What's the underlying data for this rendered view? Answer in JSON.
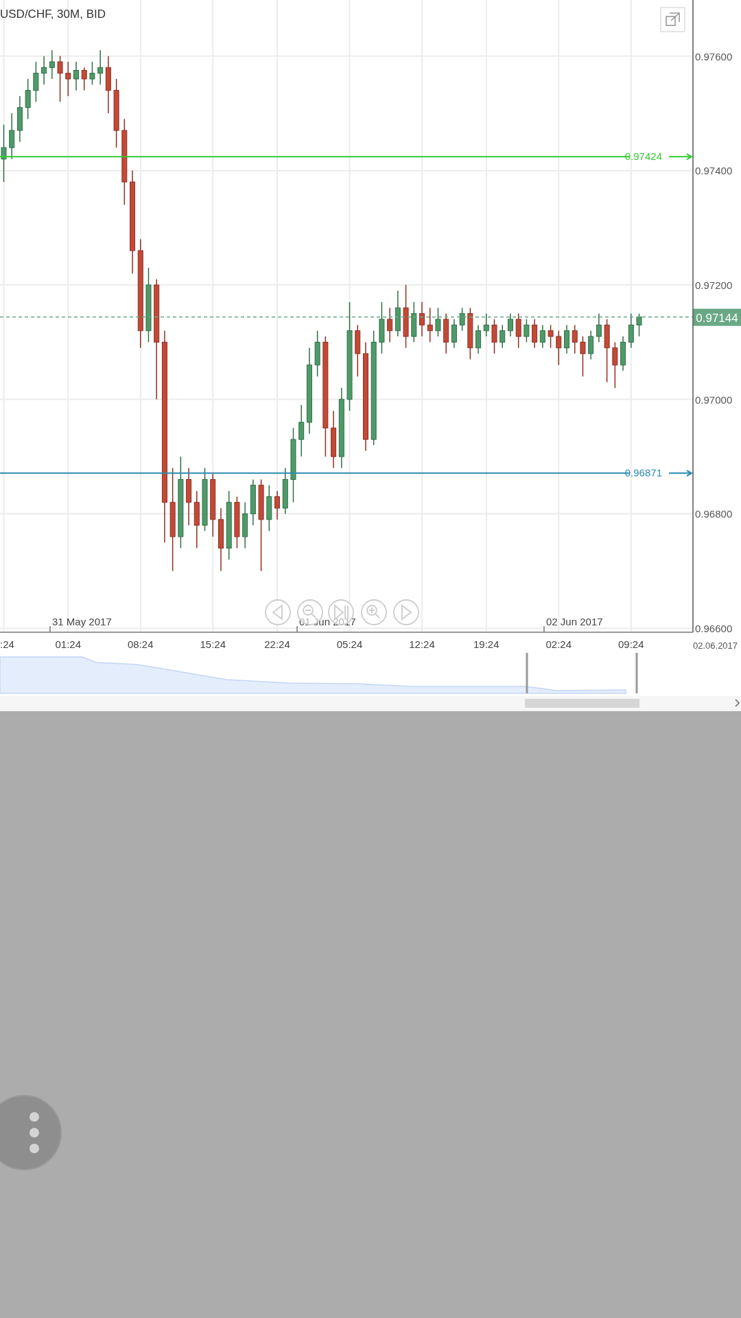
{
  "chart": {
    "title": "USD/CHF, 30M, BID",
    "date_labels": [
      "31 May 2017",
      "01 Jun 2017",
      "02 Jun 2017"
    ],
    "axis_date": "02.06.2017",
    "chart_data": {
      "type": "candlestick",
      "grid": true,
      "ylim": [
        0.96593,
        0.97698
      ],
      "ref_lines": [
        {
          "axis": "y",
          "value": 0.97424,
          "label": "0.97424",
          "color": "#33cc33"
        },
        {
          "axis": "y",
          "value": 0.96871,
          "label": "0.96871",
          "color": "#2a8bb0"
        },
        {
          "axis": "y",
          "value": 0.97144,
          "label": "0.97144",
          "color": "#6aa885"
        }
      ],
      "categories": [
        ":24",
        null,
        null,
        null,
        null,
        null,
        null,
        null,
        "01:24",
        null,
        null,
        null,
        null,
        null,
        null,
        null,
        null,
        "08:24",
        null,
        null,
        null,
        null,
        null,
        null,
        null,
        null,
        "15:24",
        null,
        null,
        null,
        null,
        null,
        null,
        null,
        "22:24",
        null,
        null,
        null,
        null,
        null,
        null,
        null,
        null,
        "05:24",
        null,
        null,
        null,
        null,
        null,
        null,
        null,
        null,
        "12:24",
        null,
        null,
        null,
        null,
        null,
        null,
        null,
        "19:24",
        null,
        null,
        null,
        null,
        null,
        null,
        null,
        null,
        "02:24",
        null,
        null,
        null,
        null,
        null,
        null,
        null,
        null,
        "09:24",
        null
      ],
      "yticks": [
        {
          "value": 0.976,
          "label": "0.97600"
        },
        {
          "value": 0.974,
          "label": "0.97400"
        },
        {
          "value": 0.972,
          "label": "0.97200"
        },
        {
          "value": 0.97,
          "label": "0.97000"
        },
        {
          "value": 0.968,
          "label": "0.96800"
        },
        {
          "value": 0.966,
          "label": "0.96600"
        }
      ],
      "ohlc": [
        [
          0.9742,
          0.9748,
          0.9738,
          0.9744
        ],
        [
          0.9744,
          0.975,
          0.9742,
          0.9747
        ],
        [
          0.9747,
          0.9753,
          0.9745,
          0.9751
        ],
        [
          0.9751,
          0.9756,
          0.9749,
          0.9754
        ],
        [
          0.9754,
          0.9759,
          0.9752,
          0.9757
        ],
        [
          0.9757,
          0.976,
          0.9755,
          0.9758
        ],
        [
          0.9758,
          0.9761,
          0.9756,
          0.9759
        ],
        [
          0.9759,
          0.976,
          0.9752,
          0.9757
        ],
        [
          0.9757,
          0.9759,
          0.9753,
          0.9756
        ],
        [
          0.9756,
          0.9759,
          0.9754,
          0.97575
        ],
        [
          0.97575,
          0.9758,
          0.9754,
          0.9756
        ],
        [
          0.9756,
          0.9759,
          0.9755,
          0.9757
        ],
        [
          0.9757,
          0.9761,
          0.9755,
          0.9758
        ],
        [
          0.9758,
          0.976,
          0.975,
          0.9754
        ],
        [
          0.9754,
          0.9756,
          0.9744,
          0.9747
        ],
        [
          0.9747,
          0.9749,
          0.9734,
          0.9738
        ],
        [
          0.9738,
          0.974,
          0.9722,
          0.9726
        ],
        [
          0.9726,
          0.9728,
          0.9709,
          0.9712
        ],
        [
          0.9712,
          0.9723,
          0.971,
          0.972
        ],
        [
          0.972,
          0.9721,
          0.97,
          0.971
        ],
        [
          0.971,
          0.9712,
          0.9675,
          0.9682
        ],
        [
          0.9682,
          0.9688,
          0.967,
          0.9676
        ],
        [
          0.9676,
          0.969,
          0.9674,
          0.9686
        ],
        [
          0.9686,
          0.9688,
          0.9678,
          0.9682
        ],
        [
          0.9682,
          0.9684,
          0.9674,
          0.9678
        ],
        [
          0.9678,
          0.9688,
          0.9677,
          0.9686
        ],
        [
          0.9686,
          0.9687,
          0.9676,
          0.9679
        ],
        [
          0.9679,
          0.9681,
          0.967,
          0.9674
        ],
        [
          0.9674,
          0.9684,
          0.9672,
          0.9682
        ],
        [
          0.9682,
          0.9683,
          0.9674,
          0.9676
        ],
        [
          0.9676,
          0.9682,
          0.9674,
          0.968
        ],
        [
          0.968,
          0.9686,
          0.9678,
          0.9685
        ],
        [
          0.9685,
          0.9686,
          0.967,
          0.9679
        ],
        [
          0.9679,
          0.9685,
          0.9677,
          0.9683
        ],
        [
          0.9683,
          0.9684,
          0.9679,
          0.9681
        ],
        [
          0.9681,
          0.9688,
          0.968,
          0.9686
        ],
        [
          0.9686,
          0.9695,
          0.9682,
          0.9693
        ],
        [
          0.9693,
          0.9699,
          0.969,
          0.9696
        ],
        [
          0.9696,
          0.9709,
          0.9694,
          0.9706
        ],
        [
          0.9706,
          0.9712,
          0.9704,
          0.971
        ],
        [
          0.971,
          0.9711,
          0.969,
          0.9695
        ],
        [
          0.9695,
          0.9698,
          0.9688,
          0.969
        ],
        [
          0.969,
          0.9702,
          0.9688,
          0.97
        ],
        [
          0.97,
          0.9717,
          0.9698,
          0.9712
        ],
        [
          0.9712,
          0.9713,
          0.9704,
          0.9708
        ],
        [
          0.9708,
          0.971,
          0.9691,
          0.9693
        ],
        [
          0.9693,
          0.9712,
          0.9692,
          0.971
        ],
        [
          0.971,
          0.9717,
          0.9708,
          0.9714
        ],
        [
          0.9714,
          0.9716,
          0.971,
          0.9712
        ],
        [
          0.9712,
          0.9719,
          0.9711,
          0.9716
        ],
        [
          0.9716,
          0.972,
          0.9709,
          0.9711
        ],
        [
          0.9711,
          0.9717,
          0.971,
          0.9715
        ],
        [
          0.9715,
          0.9717,
          0.9711,
          0.9713
        ],
        [
          0.9713,
          0.9716,
          0.971,
          0.9712
        ],
        [
          0.9712,
          0.9716,
          0.9711,
          0.9714
        ],
        [
          0.9714,
          0.9715,
          0.9708,
          0.971
        ],
        [
          0.971,
          0.9714,
          0.9709,
          0.9713
        ],
        [
          0.9713,
          0.9716,
          0.9712,
          0.9715
        ],
        [
          0.9715,
          0.9716,
          0.9707,
          0.9709
        ],
        [
          0.9709,
          0.9713,
          0.9708,
          0.9712
        ],
        [
          0.9712,
          0.9715,
          0.9711,
          0.9713
        ],
        [
          0.9713,
          0.9714,
          0.9708,
          0.971
        ],
        [
          0.971,
          0.9713,
          0.9709,
          0.9712
        ],
        [
          0.9712,
          0.9715,
          0.9711,
          0.9714
        ],
        [
          0.9714,
          0.9715,
          0.9709,
          0.9711
        ],
        [
          0.9711,
          0.9714,
          0.971,
          0.9713
        ],
        [
          0.9713,
          0.9714,
          0.9709,
          0.971
        ],
        [
          0.971,
          0.9713,
          0.9709,
          0.9712
        ],
        [
          0.9712,
          0.9713,
          0.9709,
          0.9711
        ],
        [
          0.9711,
          0.9712,
          0.9706,
          0.9709
        ],
        [
          0.9709,
          0.9713,
          0.9708,
          0.9712
        ],
        [
          0.9712,
          0.9713,
          0.9708,
          0.971
        ],
        [
          0.971,
          0.9711,
          0.9704,
          0.9708
        ],
        [
          0.9708,
          0.9712,
          0.9707,
          0.9711
        ],
        [
          0.9711,
          0.9715,
          0.971,
          0.9713
        ],
        [
          0.9713,
          0.9714,
          0.9703,
          0.9709
        ],
        [
          0.9709,
          0.971,
          0.9702,
          0.9706
        ],
        [
          0.9706,
          0.9711,
          0.9705,
          0.971
        ],
        [
          0.971,
          0.9715,
          0.9709,
          0.9713
        ],
        [
          0.9713,
          0.9715,
          0.9711,
          0.97144
        ]
      ]
    }
  }
}
